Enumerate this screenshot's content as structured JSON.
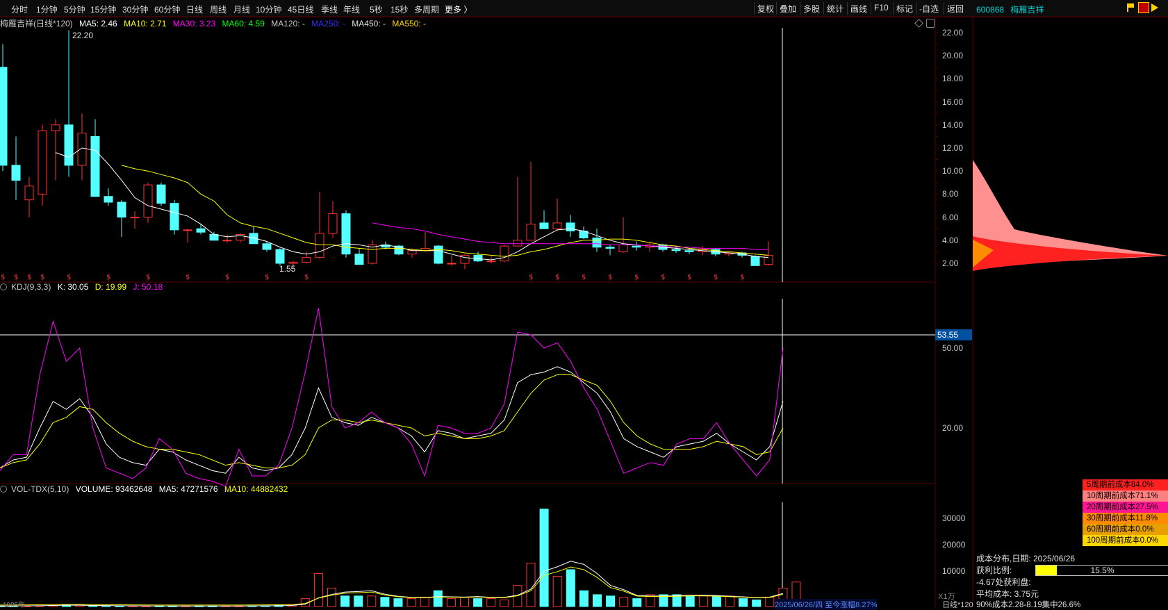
{
  "toolbar": {
    "periods": [
      "分时",
      "1分钟",
      "5分钟",
      "15分钟",
      "30分钟",
      "60分钟",
      "日线",
      "周线",
      "月线",
      "10分钟",
      "45日线",
      "季线",
      "年线",
      "5秒",
      "15秒",
      "多周期"
    ],
    "more_label": "更多 〉",
    "right_buttons": [
      "复权",
      "叠加",
      "多股",
      "统计",
      "画线",
      "F10",
      "标记",
      "-自选",
      "返回"
    ]
  },
  "stock": {
    "code": "600868",
    "name": "梅雁吉祥"
  },
  "main_legend": {
    "title": "梅雁吉祥(日线*120)",
    "ma5": "MA5: 2.46",
    "ma10": "MA10: 2.71",
    "ma30": "MA30: 3.23",
    "ma60": "MA60: 4.59",
    "ma120": "MA120: -",
    "ma250": "MA250: -",
    "ma450": "MA450: -",
    "ma550": "MA550: -"
  },
  "main_annotations": {
    "high": "22.20",
    "low": "1.55"
  },
  "price_axis": [
    "22.00",
    "20.00",
    "18.00",
    "16.00",
    "14.00",
    "12.00",
    "10.00",
    "8.00",
    "6.00",
    "4.00",
    "2.00"
  ],
  "kdj_legend": {
    "title": "KDJ(9,3,3)",
    "k": "K: 30.05",
    "d": "D: 19.99",
    "j": "J: 50.18"
  },
  "kdj_axis": [
    "50.00",
    "20.00"
  ],
  "crosshair_value": "53.55",
  "vol_legend": {
    "title": "VOL-TDX(5,10)",
    "volume": "VOLUME: 93462648",
    "ma5": "MA5: 47271576",
    "ma10": "MA10: 44882432"
  },
  "vol_axis": [
    "30000",
    "20000",
    "10000"
  ],
  "vol_unit": "X1万",
  "cost_table": [
    {
      "label": "5周期前成本84.0%",
      "color": "#ff2020"
    },
    {
      "label": "10周期前成本71.1%",
      "color": "#ff8080"
    },
    {
      "label": "20周期前成本27.5%",
      "color": "#ff1493"
    },
    {
      "label": "30周期前成本11.8%",
      "color": "#ff8c00"
    },
    {
      "label": "60周期前成本0.0%",
      "color": "#e8a000"
    },
    {
      "label": "100周期前成本0.0%",
      "color": "#ffd700"
    }
  ],
  "chip_info": {
    "date_line": "成本分布,日期:  2025/06/26",
    "profit_label": "获利比例:",
    "profit_value": "15.5%",
    "profit_ratio": 0.155,
    "profit_curve": "-4.67处获利盘:",
    "avg_cost": "平均成本:  3.75元",
    "concentration": "90%成本2.28-8.19集中26.6%"
  },
  "bottom_date": "2025/06/26/四  至今涨幅8.27%",
  "bottom_period": "日线*120",
  "bottom_left_date": "1995年",
  "colors": {
    "up": "#ff3232",
    "down": "#54ffff",
    "ma5": "#ffffff",
    "ma10": "#ffff00",
    "ma30": "#ff00ff",
    "ma60": "#00ff00",
    "k": "#ffffff",
    "d": "#ffff00",
    "j": "#ff00ff"
  },
  "chart_data": [
    {
      "type": "candlestick",
      "title": "梅雁吉祥(日线*120)",
      "ylim": [
        1.5,
        22.5
      ],
      "candles": [
        {
          "o": 19,
          "h": 21,
          "l": 10,
          "c": 10.5
        },
        {
          "o": 10.5,
          "h": 13,
          "l": 7.5,
          "c": 9.2
        },
        {
          "o": 7.5,
          "h": 9.5,
          "l": 6,
          "c": 8.7
        },
        {
          "o": 8,
          "h": 14,
          "l": 7,
          "c": 13.5
        },
        {
          "o": 13.5,
          "h": 14.5,
          "l": 9.2,
          "c": 14
        },
        {
          "o": 14,
          "h": 22.2,
          "l": 9.5,
          "c": 10.5
        },
        {
          "o": 10.5,
          "h": 15,
          "l": 9.2,
          "c": 13.3
        },
        {
          "o": 13.0,
          "h": 14.5,
          "l": 7.8,
          "c": 7.8
        },
        {
          "o": 7.8,
          "h": 8.5,
          "l": 7,
          "c": 7.3
        },
        {
          "o": 7.3,
          "h": 7.5,
          "l": 4.3,
          "c": 6.0
        },
        {
          "o": 6.0,
          "h": 6.5,
          "l": 5,
          "c": 6.0
        },
        {
          "o": 6.0,
          "h": 9,
          "l": 5.5,
          "c": 8.8
        },
        {
          "o": 8.8,
          "h": 9,
          "l": 7,
          "c": 7.2
        },
        {
          "o": 7.2,
          "h": 7.5,
          "l": 4.5,
          "c": 4.9
        },
        {
          "o": 4.9,
          "h": 5,
          "l": 3.8,
          "c": 4.9
        },
        {
          "o": 5.0,
          "h": 5.4,
          "l": 4.5,
          "c": 4.7
        },
        {
          "o": 4.5,
          "h": 4.7,
          "l": 4.0,
          "c": 4.0
        },
        {
          "o": 4.0,
          "h": 4.5,
          "l": 3.8,
          "c": 4.0
        },
        {
          "o": 4.0,
          "h": 4.6,
          "l": 3.8,
          "c": 4.5
        },
        {
          "o": 4.6,
          "h": 5.2,
          "l": 3.8,
          "c": 3.7
        },
        {
          "o": 3.7,
          "h": 3.9,
          "l": 3.0,
          "c": 3.2
        },
        {
          "o": 3.2,
          "h": 3.3,
          "l": 1.8,
          "c": 2.0
        },
        {
          "o": 2.0,
          "h": 2.2,
          "l": 1.55,
          "c": 2.1
        },
        {
          "o": 2.1,
          "h": 3.0,
          "l": 2.0,
          "c": 2.5
        },
        {
          "o": 2.5,
          "h": 8.2,
          "l": 2.4,
          "c": 4.6
        },
        {
          "o": 4.6,
          "h": 7.4,
          "l": 4.2,
          "c": 6.3
        },
        {
          "o": 6.3,
          "h": 6.6,
          "l": 2.5,
          "c": 2.8
        },
        {
          "o": 2.8,
          "h": 3.3,
          "l": 1.9,
          "c": 1.9
        },
        {
          "o": 2.0,
          "h": 4.0,
          "l": 1.9,
          "c": 3.6
        },
        {
          "o": 3.6,
          "h": 3.9,
          "l": 3.2,
          "c": 3.4
        },
        {
          "o": 3.5,
          "h": 3.6,
          "l": 2.7,
          "c": 2.8
        },
        {
          "o": 2.8,
          "h": 3.3,
          "l": 2.5,
          "c": 3.1
        },
        {
          "o": 3.1,
          "h": 4.7,
          "l": 3.0,
          "c": 3.3
        },
        {
          "o": 3.5,
          "h": 3.6,
          "l": 1.9,
          "c": 2.0
        },
        {
          "o": 2.0,
          "h": 2.7,
          "l": 1.8,
          "c": 2.0
        },
        {
          "o": 2.0,
          "h": 2.8,
          "l": 1.5,
          "c": 2.7
        },
        {
          "o": 2.7,
          "h": 3.0,
          "l": 2.1,
          "c": 2.2
        },
        {
          "o": 2.2,
          "h": 2.6,
          "l": 2.0,
          "c": 2.2
        },
        {
          "o": 2.2,
          "h": 3.6,
          "l": 2.1,
          "c": 3.5
        },
        {
          "o": 3.5,
          "h": 9.5,
          "l": 3.5,
          "c": 4.0
        },
        {
          "o": 4.0,
          "h": 10.8,
          "l": 4.0,
          "c": 5.4
        },
        {
          "o": 5.5,
          "h": 6.6,
          "l": 5.0,
          "c": 5.0
        },
        {
          "o": 5.0,
          "h": 7.6,
          "l": 4.8,
          "c": 5.5
        },
        {
          "o": 5.5,
          "h": 6.2,
          "l": 4.3,
          "c": 4.8
        },
        {
          "o": 4.8,
          "h": 5.2,
          "l": 4.1,
          "c": 4.2
        },
        {
          "o": 4.2,
          "h": 5.0,
          "l": 3.0,
          "c": 3.4
        },
        {
          "o": 3.4,
          "h": 3.6,
          "l": 2.7,
          "c": 3.3
        },
        {
          "o": 3.0,
          "h": 6.0,
          "l": 2.9,
          "c": 3.6
        },
        {
          "o": 3.5,
          "h": 3.9,
          "l": 3.1,
          "c": 3.4
        },
        {
          "o": 3.4,
          "h": 3.8,
          "l": 3.0,
          "c": 3.6
        },
        {
          "o": 3.6,
          "h": 3.7,
          "l": 3.0,
          "c": 3.2
        },
        {
          "o": 3.2,
          "h": 3.5,
          "l": 2.9,
          "c": 3.1
        },
        {
          "o": 3.1,
          "h": 3.3,
          "l": 2.8,
          "c": 3.0
        },
        {
          "o": 3.0,
          "h": 3.5,
          "l": 2.7,
          "c": 3.2
        },
        {
          "o": 3.2,
          "h": 3.3,
          "l": 2.6,
          "c": 2.8
        },
        {
          "o": 2.8,
          "h": 3.0,
          "l": 2.6,
          "c": 2.9
        },
        {
          "o": 2.9,
          "h": 3.0,
          "l": 2.5,
          "c": 2.7
        },
        {
          "o": 2.6,
          "h": 2.7,
          "l": 1.8,
          "c": 1.8
        },
        {
          "o": 1.9,
          "h": 3.9,
          "l": 1.8,
          "c": 2.7
        }
      ],
      "ma_series": [
        {
          "name": "MA5",
          "values": [
            null,
            null,
            null,
            null,
            11.6,
            11.2,
            12.0,
            11.8,
            10.6,
            9.2,
            7.7,
            7.0,
            6.7,
            6.4,
            6.1,
            5.4,
            4.5,
            4.3,
            4.4,
            4.2,
            3.9,
            3.4,
            3.0,
            2.8,
            3.0,
            3.5,
            3.7,
            3.6,
            3.4,
            3.6,
            3.4,
            3.1,
            3.1,
            3.1,
            2.8,
            2.5,
            2.4,
            2.3,
            2.5,
            3.0,
            3.7,
            4.3,
            4.9,
            5.0,
            4.8,
            4.4,
            4.0,
            3.7,
            3.6,
            3.5,
            3.4,
            3.3,
            3.2,
            3.1,
            3.0,
            2.9,
            2.8,
            2.6,
            2.5
          ]
        },
        {
          "name": "MA10",
          "values": [
            null,
            null,
            null,
            null,
            null,
            null,
            null,
            null,
            null,
            10.5,
            10.2,
            10.0,
            9.7,
            9.4,
            9.0,
            8.0,
            7.4,
            6.2,
            5.5,
            5.2,
            5.0,
            4.6,
            4.2,
            3.8,
            3.6,
            3.6,
            3.4,
            3.3,
            3.2,
            3.3,
            3.3,
            3.2,
            3.1,
            3.2,
            3.1,
            2.9,
            2.8,
            2.7,
            2.6,
            2.7,
            3.0,
            3.2,
            3.5,
            3.8,
            4.0,
            4.0,
            4.1,
            4.1,
            4.0,
            3.8,
            3.6,
            3.5,
            3.3,
            3.2,
            3.1,
            3.0,
            2.9,
            2.8,
            2.7
          ]
        },
        {
          "name": "MA30",
          "values": [
            null,
            null,
            null,
            null,
            null,
            null,
            null,
            null,
            null,
            null,
            null,
            null,
            null,
            null,
            null,
            null,
            null,
            null,
            null,
            null,
            null,
            null,
            null,
            null,
            null,
            null,
            null,
            null,
            5.5,
            5.3,
            5.1,
            5.0,
            4.8,
            4.5,
            4.3,
            4.1,
            3.9,
            3.8,
            3.7,
            3.7,
            3.7,
            3.7,
            3.7,
            3.7,
            3.7,
            3.7,
            3.6,
            3.6,
            3.6,
            3.5,
            3.5,
            3.4,
            3.4,
            3.3,
            3.3,
            3.3,
            3.3,
            3.2,
            3.2
          ]
        }
      ]
    },
    {
      "type": "line",
      "title": "KDJ(9,3,3)",
      "ylim": [
        0,
        60
      ],
      "series": [
        {
          "name": "K",
          "values": [
            5,
            8,
            9,
            20,
            30,
            27,
            31,
            24,
            14,
            9,
            7,
            6,
            12,
            11,
            8,
            6,
            4,
            3,
            9,
            5,
            4,
            5,
            10,
            20,
            35,
            24,
            22,
            21,
            24,
            22,
            20,
            17,
            11,
            19,
            18,
            16,
            17,
            18,
            23,
            37,
            40,
            41,
            43,
            41,
            37,
            33,
            26,
            16,
            13,
            11,
            9,
            13,
            14,
            15,
            18,
            14,
            11,
            8,
            13,
            30
          ]
        },
        {
          "name": "D",
          "values": [
            5,
            7,
            8,
            14,
            22,
            24,
            28,
            27,
            22,
            18,
            15,
            13,
            12,
            12,
            11,
            10,
            8,
            6,
            7,
            6,
            5,
            5,
            6,
            10,
            20,
            23,
            23,
            22,
            23,
            22,
            21,
            20,
            17,
            18,
            17,
            16,
            16,
            17,
            19,
            26,
            33,
            38,
            40,
            40,
            38,
            36,
            30,
            22,
            17,
            14,
            12,
            12,
            12,
            13,
            15,
            14,
            13,
            10,
            11,
            20
          ]
        },
        {
          "name": "J",
          "values": [
            4,
            10,
            10,
            40,
            60,
            45,
            50,
            20,
            5,
            3,
            1,
            5,
            16,
            12,
            3,
            1,
            0,
            -2,
            12,
            2,
            2,
            6,
            20,
            41,
            65,
            28,
            20,
            22,
            26,
            22,
            20,
            14,
            2,
            21,
            20,
            18,
            18,
            20,
            29,
            56,
            55,
            50,
            52,
            45,
            35,
            27,
            15,
            3,
            5,
            7,
            6,
            14,
            16,
            16,
            22,
            14,
            8,
            2,
            8,
            50
          ]
        }
      ]
    },
    {
      "type": "bar",
      "title": "VOL-TDX(5,10)",
      "ylim": [
        0,
        38000
      ],
      "categories_count": 59,
      "values": [
        200,
        150,
        200,
        300,
        400,
        500,
        700,
        300,
        250,
        200,
        200,
        200,
        200,
        200,
        200,
        200,
        200,
        200,
        200,
        250,
        300,
        400,
        800,
        3000,
        12500,
        7000,
        4000,
        4000,
        4000,
        3500,
        3000,
        3000,
        3500,
        6000,
        3000,
        3500,
        3000,
        3000,
        2500,
        8000,
        16500,
        37000,
        11500,
        14000,
        6000,
        4500,
        4000,
        3500,
        3000,
        4500,
        4500,
        4500,
        4000,
        4000,
        4000,
        4000,
        3000,
        2500,
        3500,
        7000,
        9300
      ],
      "ma5": [
        200,
        200,
        250,
        300,
        400,
        500,
        500,
        400,
        350,
        300,
        250,
        220,
        200,
        200,
        200,
        200,
        200,
        200,
        200,
        220,
        250,
        300,
        400,
        900,
        3300,
        4600,
        5500,
        5700,
        6000,
        4700,
        3900,
        3500,
        3400,
        3800,
        3700,
        3600,
        3800,
        3500,
        3500,
        4300,
        6600,
        13400,
        15100,
        17200,
        16000,
        12500,
        8000,
        6400,
        4200,
        4000,
        4000,
        4100,
        4300,
        4300,
        4200,
        3900,
        3700,
        3400,
        3600,
        5000
      ]
    }
  ]
}
